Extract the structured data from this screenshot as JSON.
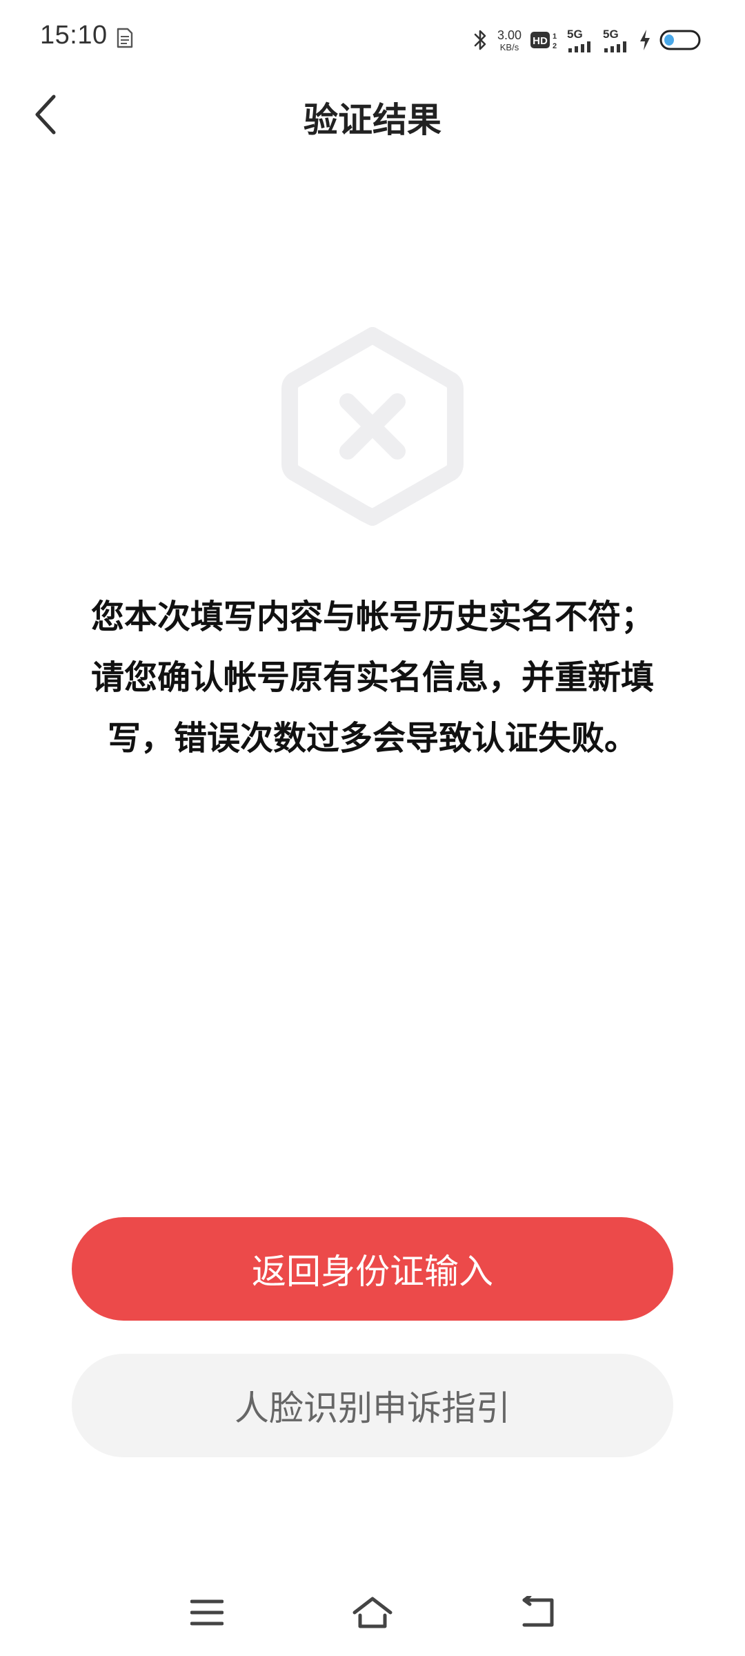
{
  "status_bar": {
    "time": "15:10",
    "network_speed_value": "3.00",
    "network_speed_unit": "KB/s",
    "network_type_1": "5G",
    "network_type_2": "5G",
    "icons": [
      "doc-notification-icon",
      "bluetooth-icon",
      "hd-icon",
      "signal-icon",
      "signal-icon",
      "charging-icon",
      "battery-icon"
    ]
  },
  "header": {
    "title": "验证结果",
    "back_icon": "chevron-left-icon"
  },
  "result": {
    "icon": "hexagon-x-icon",
    "message_lines": [
      "您本次填写内容与帐号历史实名不符；",
      "请您确认帐号原有实名信息，并重新填",
      "写，错误次数过多会导致认证失败。"
    ]
  },
  "actions": {
    "primary_label": "返回身份证输入",
    "secondary_label": "人脸识别申诉指引"
  },
  "nav_bar": {
    "icons": [
      "menu-icon",
      "home-icon",
      "back-nav-icon"
    ]
  },
  "colors": {
    "primary": "#ec4a4a",
    "secondary_bg": "#f3f3f3",
    "icon_gray": "#eeeef0"
  }
}
